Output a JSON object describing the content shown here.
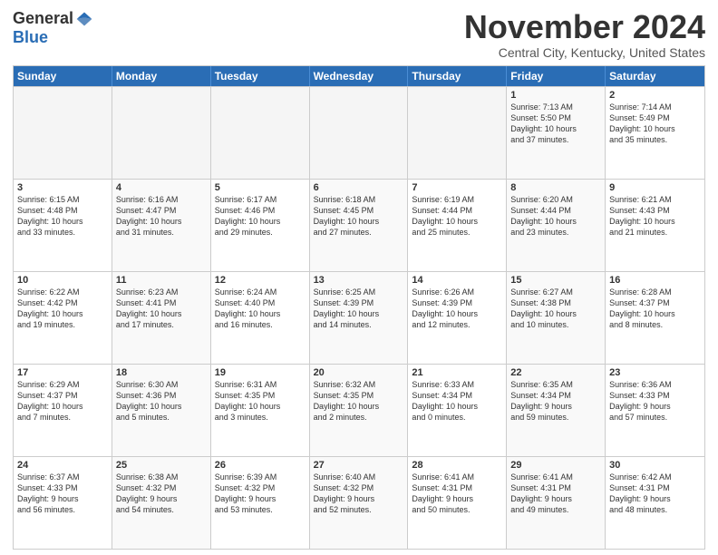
{
  "header": {
    "logo_general": "General",
    "logo_blue": "Blue",
    "month_title": "November 2024",
    "location": "Central City, Kentucky, United States"
  },
  "days_of_week": [
    "Sunday",
    "Monday",
    "Tuesday",
    "Wednesday",
    "Thursday",
    "Friday",
    "Saturday"
  ],
  "weeks": [
    [
      {
        "day": "",
        "empty": true
      },
      {
        "day": "",
        "empty": true
      },
      {
        "day": "",
        "empty": true
      },
      {
        "day": "",
        "empty": true
      },
      {
        "day": "",
        "empty": true
      },
      {
        "day": "1",
        "info": "Sunrise: 7:13 AM\nSunset: 5:50 PM\nDaylight: 10 hours\nand 37 minutes."
      },
      {
        "day": "2",
        "info": "Sunrise: 7:14 AM\nSunset: 5:49 PM\nDaylight: 10 hours\nand 35 minutes."
      }
    ],
    [
      {
        "day": "3",
        "info": "Sunrise: 6:15 AM\nSunset: 4:48 PM\nDaylight: 10 hours\nand 33 minutes."
      },
      {
        "day": "4",
        "info": "Sunrise: 6:16 AM\nSunset: 4:47 PM\nDaylight: 10 hours\nand 31 minutes."
      },
      {
        "day": "5",
        "info": "Sunrise: 6:17 AM\nSunset: 4:46 PM\nDaylight: 10 hours\nand 29 minutes."
      },
      {
        "day": "6",
        "info": "Sunrise: 6:18 AM\nSunset: 4:45 PM\nDaylight: 10 hours\nand 27 minutes."
      },
      {
        "day": "7",
        "info": "Sunrise: 6:19 AM\nSunset: 4:44 PM\nDaylight: 10 hours\nand 25 minutes."
      },
      {
        "day": "8",
        "info": "Sunrise: 6:20 AM\nSunset: 4:44 PM\nDaylight: 10 hours\nand 23 minutes."
      },
      {
        "day": "9",
        "info": "Sunrise: 6:21 AM\nSunset: 4:43 PM\nDaylight: 10 hours\nand 21 minutes."
      }
    ],
    [
      {
        "day": "10",
        "info": "Sunrise: 6:22 AM\nSunset: 4:42 PM\nDaylight: 10 hours\nand 19 minutes."
      },
      {
        "day": "11",
        "info": "Sunrise: 6:23 AM\nSunset: 4:41 PM\nDaylight: 10 hours\nand 17 minutes."
      },
      {
        "day": "12",
        "info": "Sunrise: 6:24 AM\nSunset: 4:40 PM\nDaylight: 10 hours\nand 16 minutes."
      },
      {
        "day": "13",
        "info": "Sunrise: 6:25 AM\nSunset: 4:39 PM\nDaylight: 10 hours\nand 14 minutes."
      },
      {
        "day": "14",
        "info": "Sunrise: 6:26 AM\nSunset: 4:39 PM\nDaylight: 10 hours\nand 12 minutes."
      },
      {
        "day": "15",
        "info": "Sunrise: 6:27 AM\nSunset: 4:38 PM\nDaylight: 10 hours\nand 10 minutes."
      },
      {
        "day": "16",
        "info": "Sunrise: 6:28 AM\nSunset: 4:37 PM\nDaylight: 10 hours\nand 8 minutes."
      }
    ],
    [
      {
        "day": "17",
        "info": "Sunrise: 6:29 AM\nSunset: 4:37 PM\nDaylight: 10 hours\nand 7 minutes."
      },
      {
        "day": "18",
        "info": "Sunrise: 6:30 AM\nSunset: 4:36 PM\nDaylight: 10 hours\nand 5 minutes."
      },
      {
        "day": "19",
        "info": "Sunrise: 6:31 AM\nSunset: 4:35 PM\nDaylight: 10 hours\nand 3 minutes."
      },
      {
        "day": "20",
        "info": "Sunrise: 6:32 AM\nSunset: 4:35 PM\nDaylight: 10 hours\nand 2 minutes."
      },
      {
        "day": "21",
        "info": "Sunrise: 6:33 AM\nSunset: 4:34 PM\nDaylight: 10 hours\nand 0 minutes."
      },
      {
        "day": "22",
        "info": "Sunrise: 6:35 AM\nSunset: 4:34 PM\nDaylight: 9 hours\nand 59 minutes."
      },
      {
        "day": "23",
        "info": "Sunrise: 6:36 AM\nSunset: 4:33 PM\nDaylight: 9 hours\nand 57 minutes."
      }
    ],
    [
      {
        "day": "24",
        "info": "Sunrise: 6:37 AM\nSunset: 4:33 PM\nDaylight: 9 hours\nand 56 minutes."
      },
      {
        "day": "25",
        "info": "Sunrise: 6:38 AM\nSunset: 4:32 PM\nDaylight: 9 hours\nand 54 minutes."
      },
      {
        "day": "26",
        "info": "Sunrise: 6:39 AM\nSunset: 4:32 PM\nDaylight: 9 hours\nand 53 minutes."
      },
      {
        "day": "27",
        "info": "Sunrise: 6:40 AM\nSunset: 4:32 PM\nDaylight: 9 hours\nand 52 minutes."
      },
      {
        "day": "28",
        "info": "Sunrise: 6:41 AM\nSunset: 4:31 PM\nDaylight: 9 hours\nand 50 minutes."
      },
      {
        "day": "29",
        "info": "Sunrise: 6:41 AM\nSunset: 4:31 PM\nDaylight: 9 hours\nand 49 minutes."
      },
      {
        "day": "30",
        "info": "Sunrise: 6:42 AM\nSunset: 4:31 PM\nDaylight: 9 hours\nand 48 minutes."
      }
    ]
  ]
}
